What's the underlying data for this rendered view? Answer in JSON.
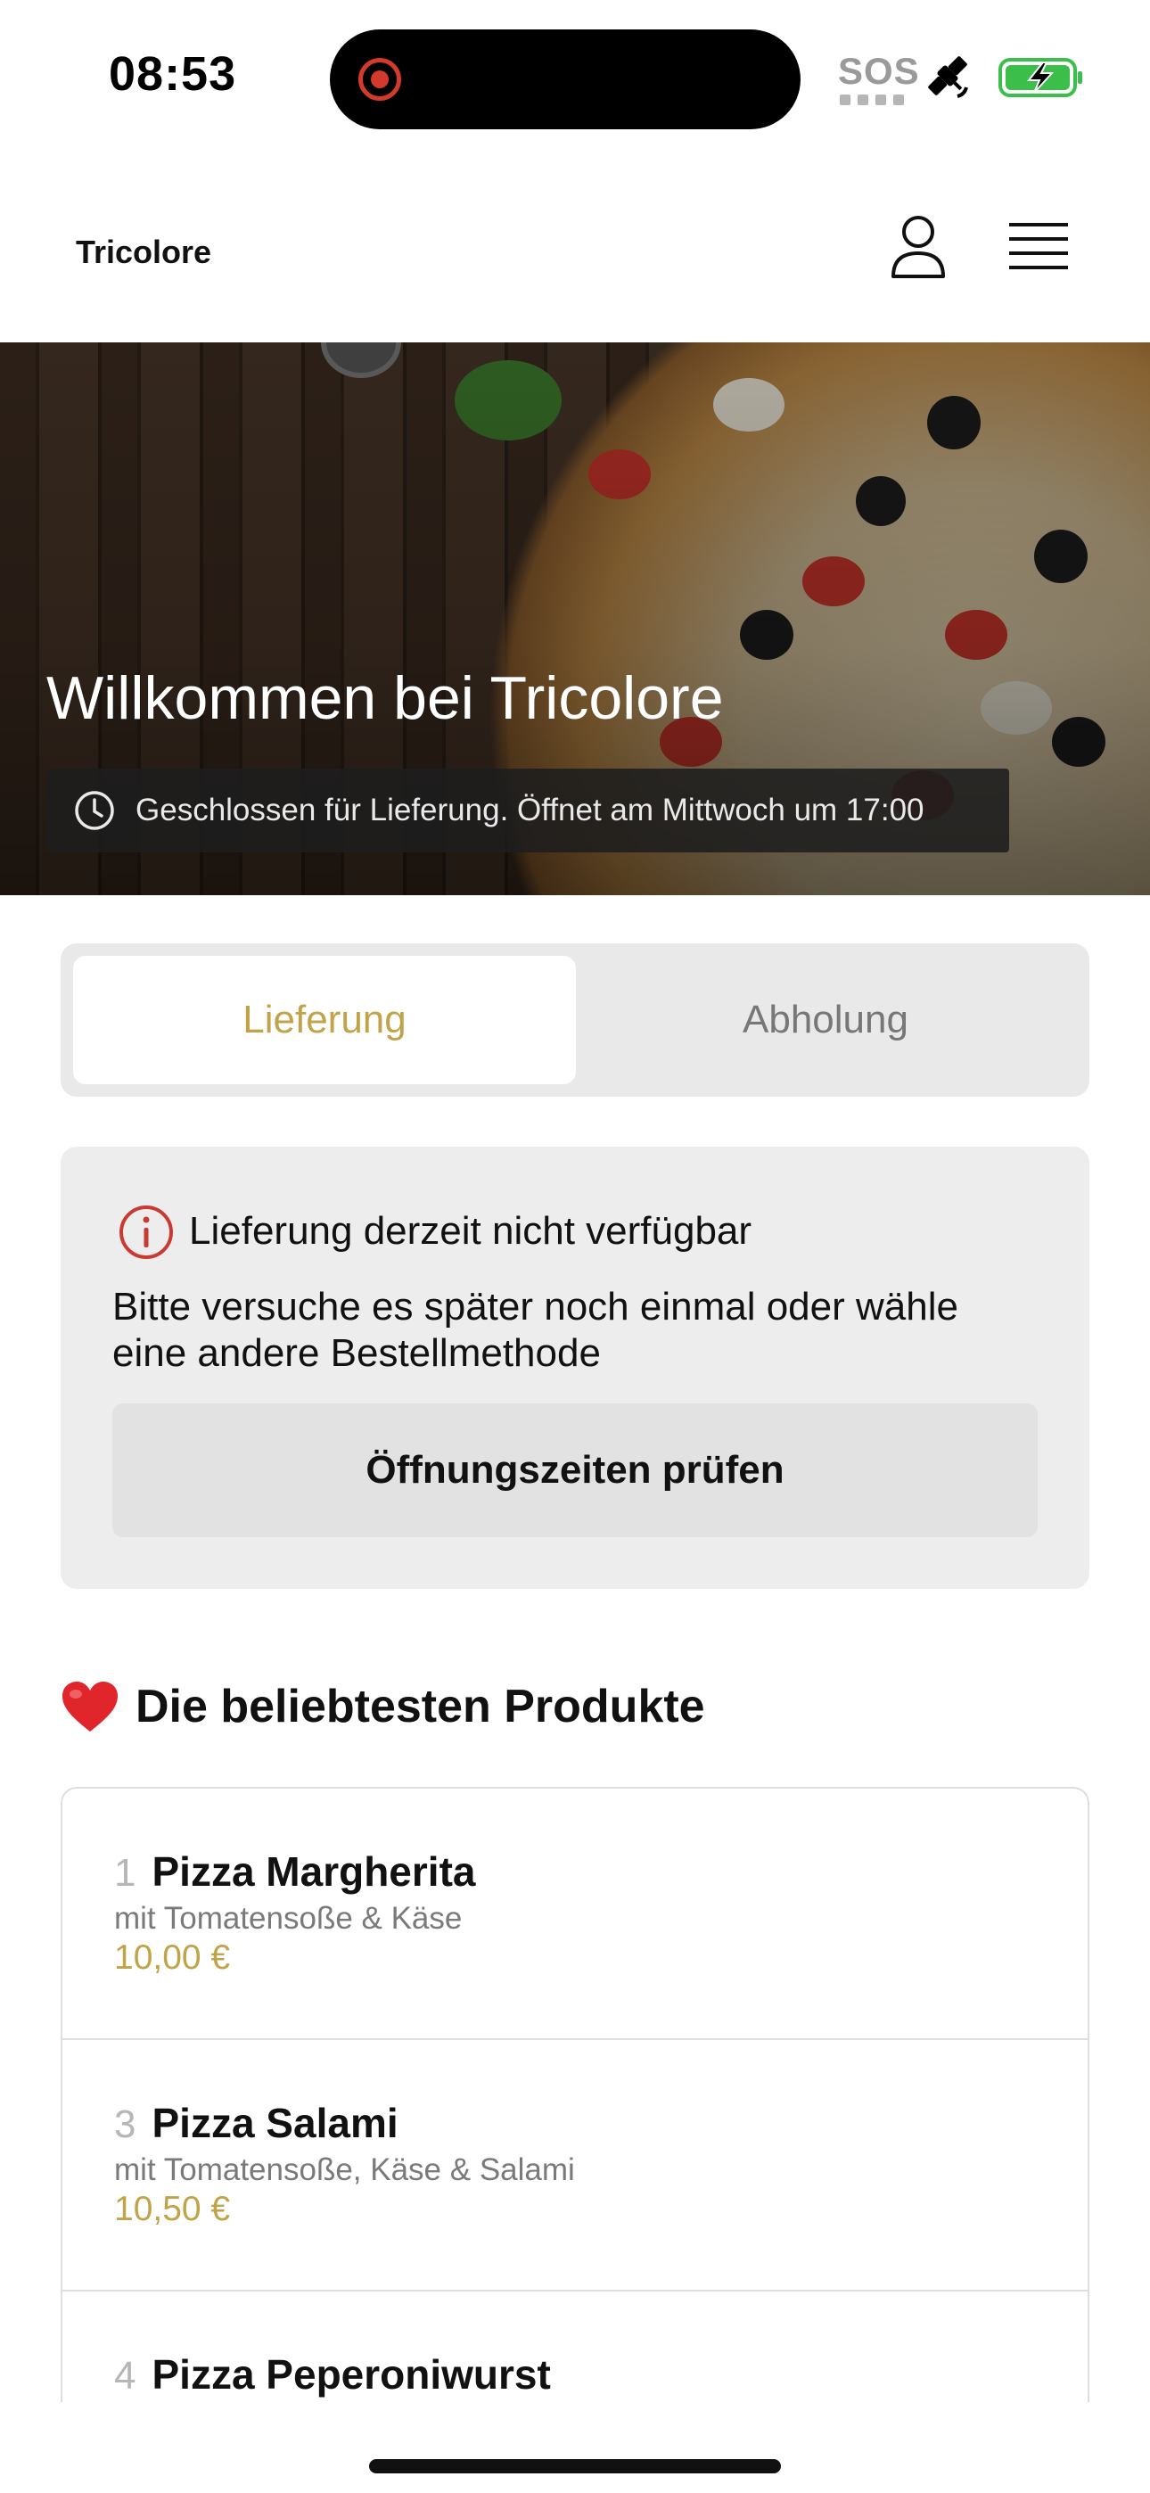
{
  "status_bar": {
    "time": "08:53",
    "sos_label": "SOS",
    "icons": [
      "screen-recording-icon",
      "satellite-icon",
      "battery-charging-icon"
    ]
  },
  "header": {
    "brand": "Tricolore",
    "icons": [
      "user-icon",
      "menu-icon"
    ]
  },
  "hero": {
    "title": "Willkommen bei Tricolore",
    "status_text": "Geschlossen für Lieferung. Öffnet am Mittwoch um 17:00",
    "status_icon": "clock-icon"
  },
  "order_mode": {
    "options": [
      {
        "label": "Lieferung",
        "active": true
      },
      {
        "label": "Abholung",
        "active": false
      }
    ]
  },
  "alert": {
    "icon": "info-icon",
    "title": "Lieferung derzeit nicht verfügbar",
    "message": "Bitte versuche es später noch einmal oder wähle eine andere Bestellmethode",
    "button_label": "Öffnungszeiten prüfen"
  },
  "popular": {
    "title": "Die beliebtesten Produkte",
    "icon": "heart-icon",
    "products": [
      {
        "rank": "1",
        "name": "Pizza Margherita",
        "description": "mit Tomatensoße & Käse",
        "price": "10,00 €"
      },
      {
        "rank": "3",
        "name": "Pizza Salami",
        "description": "mit Tomatensoße, Käse & Salami",
        "price": "10,50 €"
      },
      {
        "rank": "4",
        "name": "Pizza Peperoniwurst",
        "description": "",
        "price": ""
      }
    ]
  },
  "colors": {
    "accent": "#c1a349",
    "alert_red": "#c83a32",
    "card_bg": "#ededed"
  }
}
